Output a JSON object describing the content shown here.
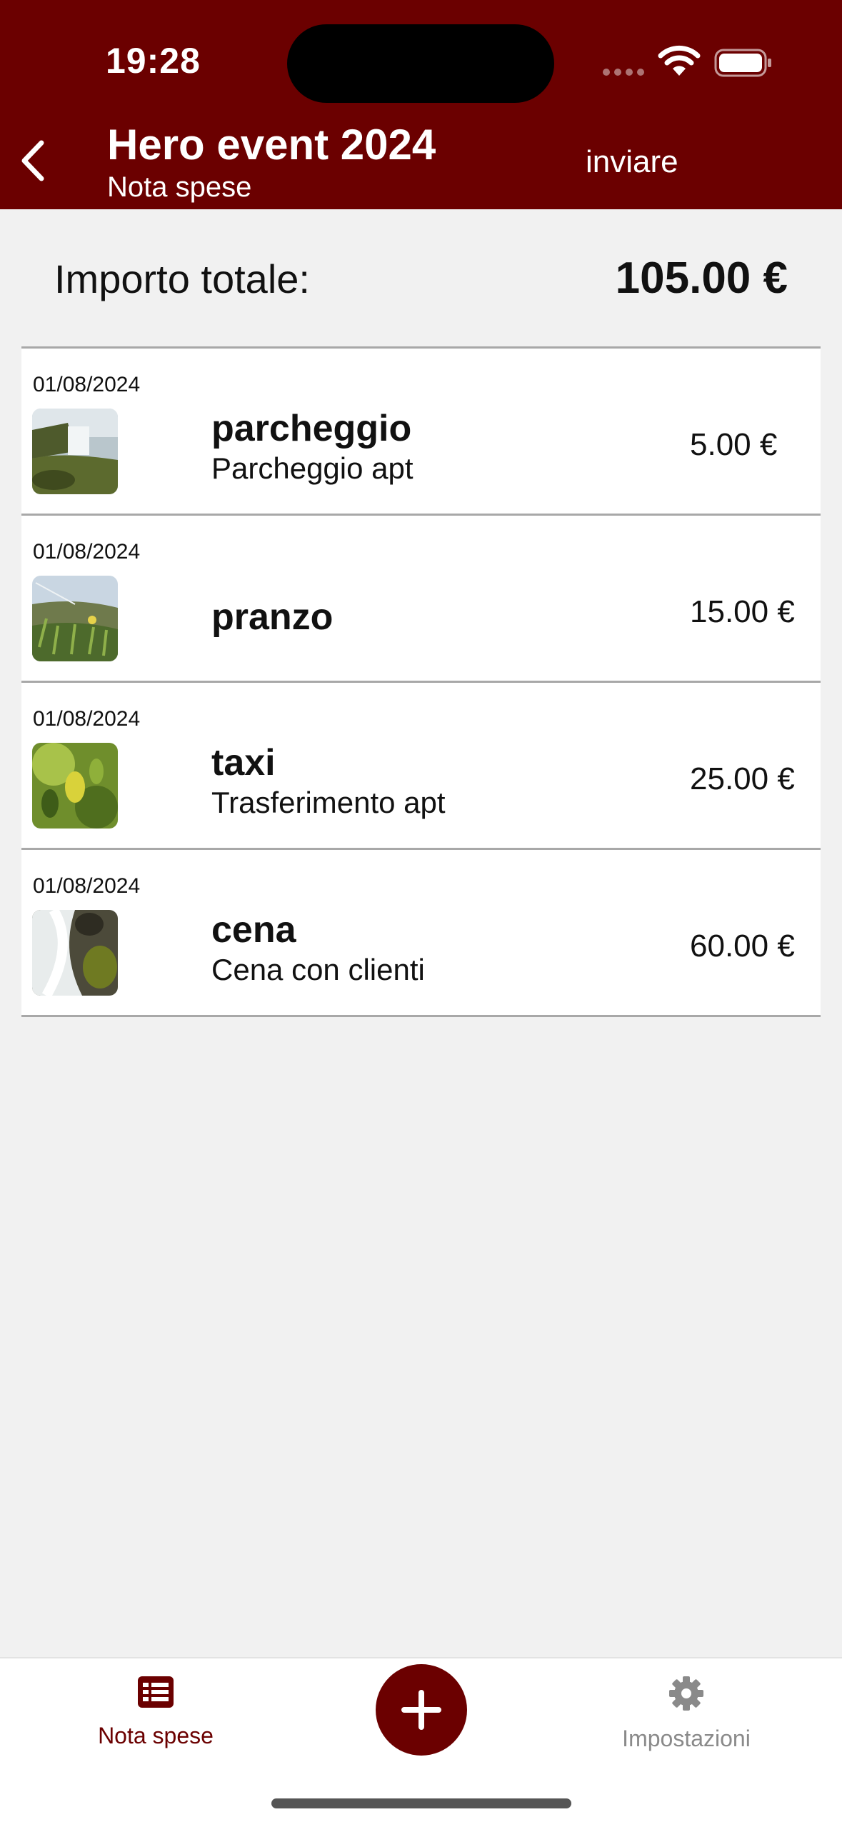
{
  "status_bar": {
    "time": "19:28"
  },
  "header": {
    "title": "Hero event 2024",
    "subtitle": "Nota spese",
    "send_label": "inviare"
  },
  "total": {
    "label": "Importo totale:",
    "value": "105.00 €"
  },
  "expenses": [
    {
      "date": "01/08/2024",
      "category": "parcheggio",
      "description": "Parcheggio apt",
      "amount": "5.00 €",
      "thumbnail": "waterfall-photo"
    },
    {
      "date": "01/08/2024",
      "category": "pranzo",
      "description": "",
      "amount": "15.00 €",
      "thumbnail": "meadow-photo"
    },
    {
      "date": "01/08/2024",
      "category": "taxi",
      "description": "Trasferimento apt",
      "amount": "25.00 €",
      "thumbnail": "leaves-photo"
    },
    {
      "date": "01/08/2024",
      "category": "cena",
      "description": "Cena con clienti",
      "amount": "60.00 €",
      "thumbnail": "stream-photo"
    }
  ],
  "tabbar": {
    "notes_label": "Nota spese",
    "settings_label": "Impostazioni",
    "add_icon": "plus-icon"
  },
  "colors": {
    "brand": "#6b0000",
    "background": "#f1f1f1",
    "inactive_tab": "#8a8a8a"
  }
}
